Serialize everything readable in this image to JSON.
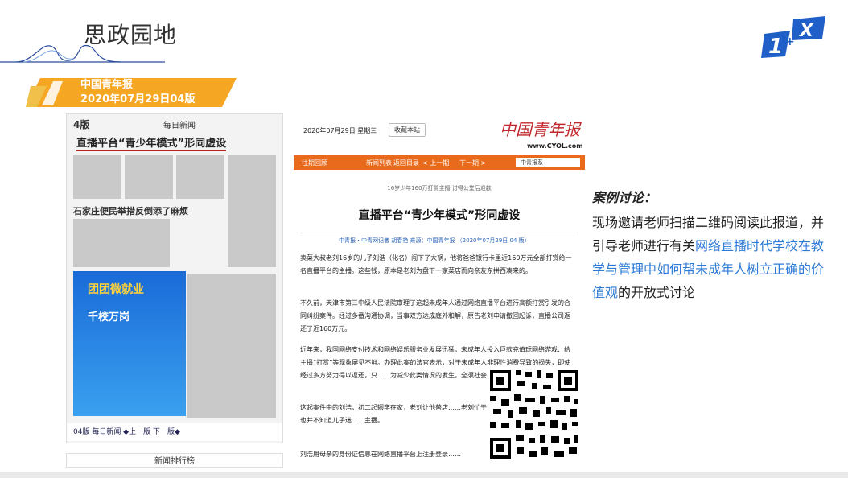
{
  "slide": {
    "title": "思政园地"
  },
  "logo": {
    "icon": "1x-logo-icon",
    "text": "1+X"
  },
  "source": {
    "line1": "中国青年报",
    "line2": "2020年07月29日04版"
  },
  "paper": {
    "page_label": "4版",
    "section": "每日新闻",
    "headline": "直播平台“青少年模式”形同虚设",
    "subhead": "石家庄便民举措反倒添了麻烦",
    "ad_title": "团团微就业",
    "ad_sub": "千校万岗",
    "footer": "04版 每日新闻  ◆上一版  下一版◆",
    "rank": "新闻排行榜"
  },
  "web": {
    "date": "2020年07月29日 星期三",
    "favorite": "收藏本站",
    "logo_text": "中国青年报",
    "url": "www.CYOL.com",
    "nav": [
      "往期回顾",
      "新闻列表",
      "返回目录",
      "< 上一期",
      "下一期 >"
    ],
    "select": "中青报系",
    "kicker": "16岁少年160万打赏主播 讨得公堂后退款",
    "headline": "直播平台“青少年模式”形同虚设",
    "byline": "中青报・中青网记者 胡春艳  来源：中国青年报  （2020年07月29日  04 版）",
    "paragraphs": [
      "卖菜大叔老刘16岁的儿子刘浩（化名）闯下了大祸，他将爸爸银行卡里近160万元全部打赏给一名直播平台的主播。这些钱，原本是老刘为盘下一家菜店而向亲友东拼西凑来的。",
      "不久前，天津市第三中级人民法院审理了这起未成年人通过网络直播平台进行高额打赏引发的合同纠纷案件。经过多番沟通协调，当事双方达成庭外和解，原告老刘申请撤回起诉，直播公司返还了近160万元。",
      "近年来，我国网络支付技术和网络娱乐服务业发展迅猛，未成年人投入巨款充值玩网络游戏、给主播“打赏”等现象屡见不鲜。办理此案的法官表示，对于未成年人非理性消费导致的损失，即使经过多方努力得以返还，只……为减少此类情况的发生，全须社会各方进行有效引导和……",
      "这起案件中的刘浩，初二起辍学在家，老刘让他替店……老刘忙于生计，很少过问儿子的生活，也并不知道儿子迷……主播。",
      "刘浩用母亲的身份证信息在网络直播平台上注册登录……"
    ]
  },
  "qr": {
    "icon": "qr-code-icon"
  },
  "case": {
    "label": "案例讨论：",
    "text_before": "现场邀请老师扫描二维码阅读此报道，并引导老师进行有关",
    "highlight": "网络直播时代学校在教学与管理中如何帮未成年人树立正确的价值观",
    "text_after": "的开放式讨论"
  },
  "colors": {
    "accent_blue": "#2e7bd6",
    "banner_orange": "#f5a623",
    "nav_orange": "#e96a1c",
    "paper_red": "#c0282d"
  }
}
